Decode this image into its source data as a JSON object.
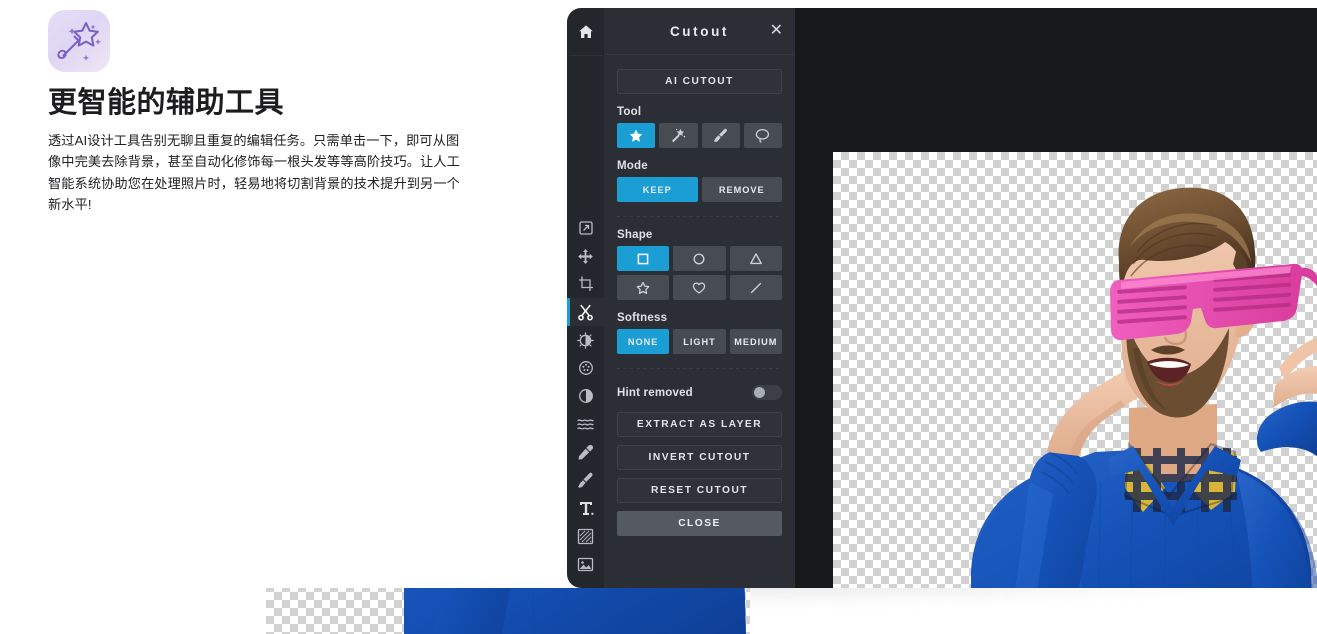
{
  "hero": {
    "icon": "magic-wand-icon",
    "title": "更智能的辅助工具",
    "body": "透过AI设计工具告别无聊且重复的编辑任务。只需单击一下，即可从图像中完美去除背景，甚至自动化修饰每一根头发等等高阶技巧。让人工智能系统协助您在处理照片时，轻易地将切割背景的技术提升到另一个新水平!"
  },
  "toolbar": {
    "home_icon": "home-icon",
    "items": [
      {
        "icon": "resize-icon",
        "active": false
      },
      {
        "icon": "move-icon",
        "active": false
      },
      {
        "icon": "crop-icon",
        "active": false
      },
      {
        "icon": "scissors-cutout-icon",
        "active": true
      },
      {
        "icon": "brightness-icon",
        "active": false
      },
      {
        "icon": "effects-icon",
        "active": false
      },
      {
        "icon": "contrast-icon",
        "active": false
      },
      {
        "icon": "liquify-waves-icon",
        "active": false
      },
      {
        "icon": "eyedropper-icon",
        "active": false
      },
      {
        "icon": "paintbrush-icon",
        "active": false
      },
      {
        "icon": "text-icon",
        "active": false
      },
      {
        "icon": "texture-icon",
        "active": false
      },
      {
        "icon": "image-icon",
        "active": false
      }
    ]
  },
  "panel": {
    "title": "Cutout",
    "close_icon": "close-icon",
    "ai_cutout_label": "AI CUTOUT",
    "tool": {
      "label": "Tool",
      "options": [
        {
          "icon": "star-tool-icon",
          "selected": true
        },
        {
          "icon": "magic-wand-tool-icon",
          "selected": false
        },
        {
          "icon": "brush-tool-icon",
          "selected": false
        },
        {
          "icon": "lasso-tool-icon",
          "selected": false
        }
      ]
    },
    "mode": {
      "label": "Mode",
      "options": [
        {
          "label": "KEEP",
          "selected": true
        },
        {
          "label": "REMOVE",
          "selected": false
        }
      ]
    },
    "shape": {
      "label": "Shape",
      "options": [
        {
          "icon": "square-shape-icon",
          "selected": true
        },
        {
          "icon": "circle-shape-icon",
          "selected": false
        },
        {
          "icon": "triangle-shape-icon",
          "selected": false
        },
        {
          "icon": "star-shape-icon",
          "selected": false
        },
        {
          "icon": "heart-shape-icon",
          "selected": false
        },
        {
          "icon": "line-shape-icon",
          "selected": false
        }
      ]
    },
    "softness": {
      "label": "Softness",
      "options": [
        {
          "label": "NONE",
          "selected": true
        },
        {
          "label": "LIGHT",
          "selected": false
        },
        {
          "label": "MEDIUM",
          "selected": false
        }
      ]
    },
    "hint": {
      "label": "Hint removed",
      "toggle_on": false
    },
    "actions": [
      {
        "label": "EXTRACT AS LAYER"
      },
      {
        "label": "INVERT CUTOUT"
      },
      {
        "label": "RESET CUTOUT"
      }
    ],
    "close_label": "CLOSE"
  },
  "canvas": {
    "background_pattern": "transparency-checkerboard",
    "content": "photo-man-with-pink-shutter-glasses-blue-sweater"
  },
  "colors": {
    "accent_blue": "#1a9ed4",
    "panel_bg": "#2b2e34",
    "toolbar_bg": "#23262b",
    "canvas_bg": "#16181a",
    "cell_bg": "#474b52",
    "close_btn_bg": "#555a61",
    "hero_icon_purple": "#7b5fc4",
    "sweater_blue": "#1552b8",
    "glasses_pink": "#e84bb0"
  }
}
